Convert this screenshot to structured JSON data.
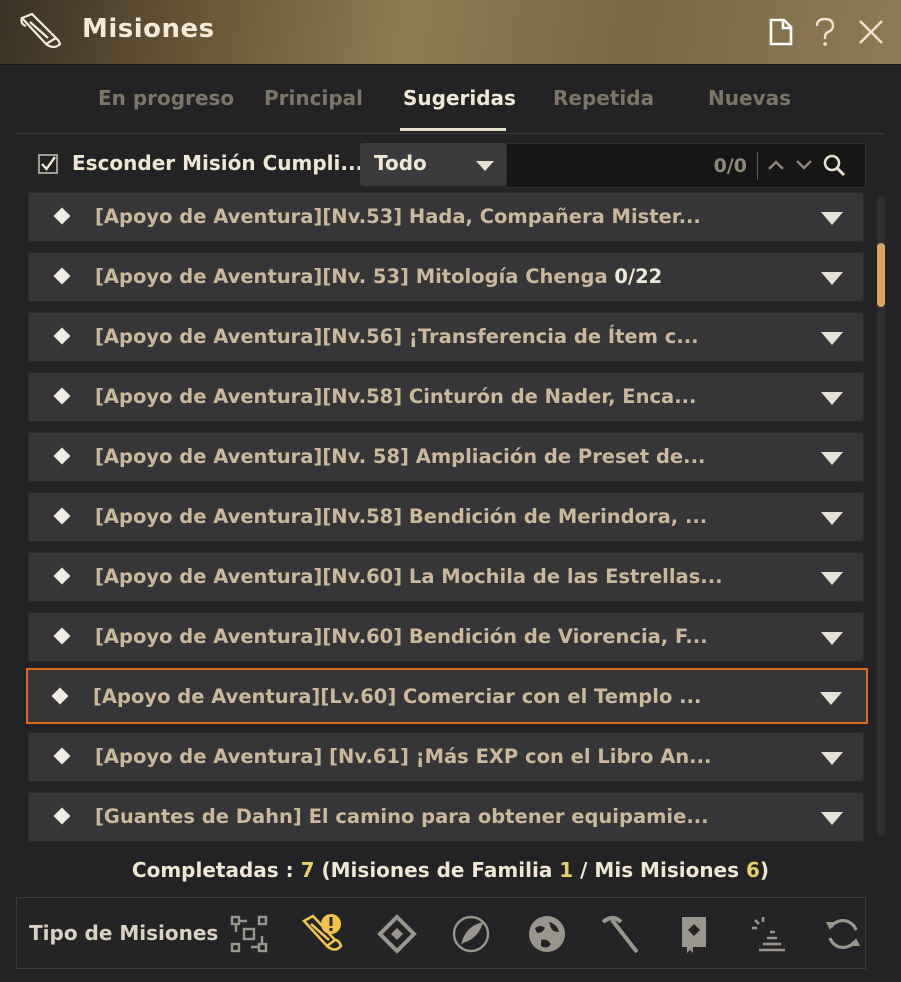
{
  "window": {
    "title": "Misiones"
  },
  "tabs": [
    {
      "label": "En progreso"
    },
    {
      "label": "Principal"
    },
    {
      "label": "Sugeridas"
    },
    {
      "label": "Repetida"
    },
    {
      "label": "Nuevas"
    }
  ],
  "active_tab": "Sugeridas",
  "filter": {
    "hide_completed_label": "Esconder Misión Cumpli...",
    "hide_completed_checked": true,
    "dropdown_value": "Todo",
    "search_value": "",
    "search_counter": "0/0"
  },
  "quests": [
    {
      "text": "[Apoyo de Aventura][Nv.53] Hada, Compañera Mister...",
      "progress": ""
    },
    {
      "text": "[Apoyo de Aventura][Nv. 53] Mitología Chenga ",
      "progress": "0/22"
    },
    {
      "text": "[Apoyo de Aventura][Nv.56] ¡Transferencia de Ítem c...",
      "progress": ""
    },
    {
      "text": "[Apoyo de Aventura][Nv.58] Cinturón de Nader, Enca...",
      "progress": ""
    },
    {
      "text": "[Apoyo de Aventura][Nv. 58] Ampliación de Preset de...",
      "progress": ""
    },
    {
      "text": "[Apoyo de Aventura][Nv.58] Bendición de Merindora, ...",
      "progress": ""
    },
    {
      "text": "[Apoyo de Aventura][Nv.60] La Mochila de las Estrellas...",
      "progress": ""
    },
    {
      "text": "[Apoyo de Aventura][Nv.60] Bendición de Viorencia, F...",
      "progress": ""
    },
    {
      "text": "[Apoyo de Aventura][Lv.60] Comerciar con el Templo ...",
      "progress": ""
    },
    {
      "text": "[Apoyo de Aventura] [Nv.61] ¡Más EXP con el Libro An...",
      "progress": ""
    },
    {
      "text": "[Guantes de Dahn] El camino para obtener equipamie...",
      "progress": ""
    }
  ],
  "selected_quest_index": 8,
  "completed": {
    "label": "Completadas : ",
    "total": "7",
    "open_paren": " (Misiones de Familia ",
    "family": "1",
    "sep": " / Mis Misiones ",
    "mine": "6",
    "close_paren": ")"
  },
  "quest_types": {
    "label": "Tipo de Misiones",
    "icons": [
      "nodes-icon",
      "quest-scroll-alert-icon",
      "diamond-rune-icon",
      "feather-icon",
      "globe-icon",
      "pickaxe-icon",
      "book-icon",
      "sparkle-cone-icon",
      "refresh-icon"
    ],
    "active_index": 1
  },
  "colors": {
    "accent": "#e06a1b",
    "highlight": "#e5d06e",
    "title_gold": "#8e7a52"
  }
}
